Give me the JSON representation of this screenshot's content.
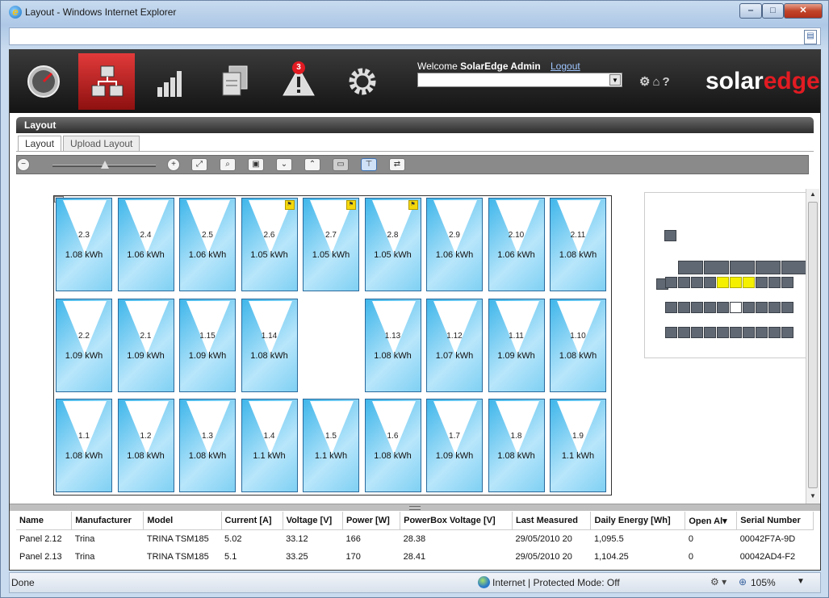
{
  "window": {
    "title": "Layout - Windows Internet Explorer"
  },
  "header": {
    "welcome_prefix": "Welcome",
    "user_name": "SolarEdge Admin",
    "logout": "Logout",
    "alert_count": "3",
    "logo_solar": "solar",
    "logo_edge": "edge",
    "util_icons": "⚙⌂?"
  },
  "app": {
    "title": "Layout",
    "tabs": [
      {
        "label": "Layout"
      },
      {
        "label": "Upload Layout"
      }
    ]
  },
  "panels": {
    "row1": [
      {
        "name": "2.3",
        "energy": "1.08 kWh",
        "flag": false
      },
      {
        "name": "2.4",
        "energy": "1.06 kWh",
        "flag": false
      },
      {
        "name": "2.5",
        "energy": "1.06 kWh",
        "flag": false
      },
      {
        "name": "2.6",
        "energy": "1.05 kWh",
        "flag": true
      },
      {
        "name": "2.7",
        "energy": "1.05 kWh",
        "flag": true
      },
      {
        "name": "2.8",
        "energy": "1.05 kWh",
        "flag": true
      },
      {
        "name": "2.9",
        "energy": "1.06 kWh",
        "flag": false
      },
      {
        "name": "2.10",
        "energy": "1.06 kWh",
        "flag": false
      },
      {
        "name": "2.11",
        "energy": "1.08 kWh",
        "flag": false
      }
    ],
    "row2": [
      {
        "name": "2.2",
        "energy": "1.09 kWh"
      },
      {
        "name": "2.1",
        "energy": "1.09 kWh"
      },
      {
        "name": "1.15",
        "energy": "1.09 kWh"
      },
      {
        "name": "1.14",
        "energy": "1.08 kWh"
      },
      null,
      {
        "name": "1.13",
        "energy": "1.08 kWh"
      },
      {
        "name": "1.12",
        "energy": "1.07 kWh"
      },
      {
        "name": "1.11",
        "energy": "1.09 kWh"
      },
      {
        "name": "1.10",
        "energy": "1.08 kWh"
      }
    ],
    "row3": [
      {
        "name": "1.1",
        "energy": "1.08 kWh"
      },
      {
        "name": "1.2",
        "energy": "1.08 kWh"
      },
      {
        "name": "1.3",
        "energy": "1.08 kWh"
      },
      {
        "name": "1.4",
        "energy": "1.1 kWh"
      },
      {
        "name": "1.5",
        "energy": "1.1 kWh"
      },
      {
        "name": "1.6",
        "energy": "1.08 kWh"
      },
      {
        "name": "1.7",
        "energy": "1.09 kWh"
      },
      {
        "name": "1.8",
        "energy": "1.08 kWh"
      },
      {
        "name": "1.9",
        "energy": "1.1 kWh"
      }
    ]
  },
  "table": {
    "columns": [
      "Name",
      "Manufacturer",
      "Model",
      "Current [A]",
      "Voltage [V]",
      "Power [W]",
      "PowerBox Voltage [V]",
      "Last Measured",
      "Daily Energy [Wh]",
      "Open Al▾",
      "Serial Number"
    ],
    "rows": [
      [
        "Panel 2.12",
        "Trina",
        "TRINA TSM185",
        "5.02",
        "33.12",
        "166",
        "28.38",
        "29/05/2010 20",
        "1,095.5",
        "0",
        "00042F7A-9D"
      ],
      [
        "Panel 2.13",
        "Trina",
        "TRINA TSM185",
        "5.1",
        "33.25",
        "170",
        "28.41",
        "29/05/2010 20",
        "1,104.25",
        "0",
        "00042AD4-F2"
      ]
    ]
  },
  "status": {
    "done": "Done",
    "zone": "Internet | Protected Mode: Off",
    "zoom": "105%"
  },
  "colors": {
    "accent_red": "#e21b22",
    "panel_blue": "#3fb6ea",
    "flag_yellow": "#f5d80c"
  }
}
